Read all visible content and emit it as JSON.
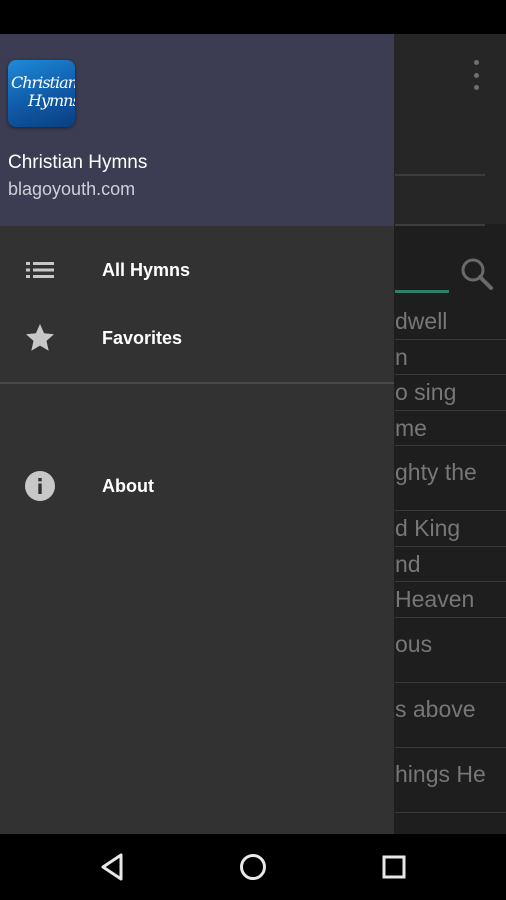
{
  "drawer": {
    "header": {
      "app_name": "Christian Hymns",
      "website": "blagoyouth.com",
      "logo_line1": "Christian",
      "logo_line2": "Hymns"
    },
    "items": [
      {
        "label": "All Hymns",
        "icon": "list-icon"
      },
      {
        "label": "Favorites",
        "icon": "star-icon"
      },
      {
        "label": "About",
        "icon": "info-icon"
      }
    ]
  },
  "background": {
    "list_fragments": [
      "dwell",
      "n",
      "o sing",
      "me",
      "ghty the",
      "d King",
      "nd",
      "Heaven",
      "ous",
      "s above",
      "",
      "hings He"
    ]
  },
  "colors": {
    "drawer_header": "#3c3c52",
    "drawer_body": "#323232",
    "accent": "#2f7f6b"
  }
}
